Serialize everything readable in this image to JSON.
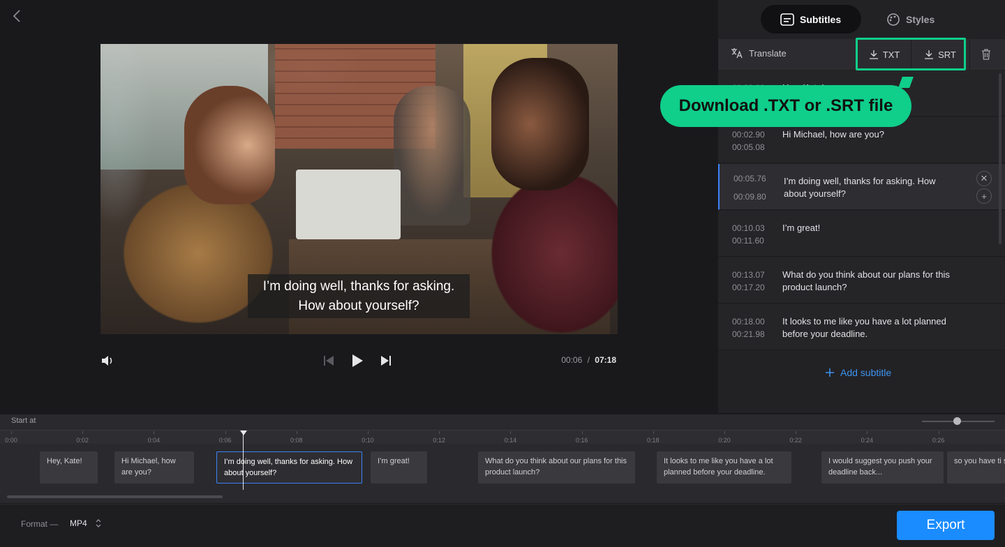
{
  "video": {
    "caption_line1": "I’m doing well, thanks for asking.",
    "caption_line2": "How about yourself?",
    "current_time": "00:06",
    "separator": "/",
    "total_time": "07:18"
  },
  "panel": {
    "tabs": [
      {
        "label": "Subtitles",
        "icon": "subtitles-icon",
        "active": true
      },
      {
        "label": "Styles",
        "icon": "palette-icon",
        "active": false
      }
    ],
    "toolbar": {
      "translate_label": "Translate",
      "txt_label": "TXT",
      "srt_label": "SRT"
    },
    "subtitles": [
      {
        "start": "00:00.00",
        "end": "",
        "text": "Hey, Kate!"
      },
      {
        "start": "00:02.90",
        "end": "00:05.08",
        "text": "Hi Michael, how are you?"
      },
      {
        "start": "00:05.76",
        "end": "00:09.80",
        "text": "I’m doing well, thanks for asking. How about yourself?",
        "selected": true
      },
      {
        "start": "00:10.03",
        "end": "00:11.60",
        "text": "I’m great!"
      },
      {
        "start": "00:13.07",
        "end": "00:17.20",
        "text": "What do you think about our plans for this product launch?"
      },
      {
        "start": "00:18.00",
        "end": "00:21.98",
        "text": "It looks to me like you have a lot planned before your deadline."
      }
    ],
    "add_subtitle_label": "Add subtitle"
  },
  "tooltip": {
    "text": "Download .TXT or .SRT file"
  },
  "timeline": {
    "start_at_label": "Start at",
    "ticks": [
      "0:00",
      "0:02",
      "0:04",
      "0:06",
      "0:08",
      "0:10",
      "0:12",
      "0:14",
      "0:16",
      "0:18",
      "0:20",
      "0:22",
      "0:24",
      "0:26"
    ],
    "clips": [
      {
        "text": "Hey, Kate!"
      },
      {
        "text": "Hi Michael, how are you?"
      },
      {
        "text": "I’m doing well, thanks for asking. How about yourself?",
        "selected": true
      },
      {
        "text": "I’m great!"
      },
      {
        "text": "What do you think about our plans for this product launch?"
      },
      {
        "text": "It looks to me like you have a lot planned before your deadline."
      },
      {
        "text": "I would suggest you push your deadline back..."
      },
      {
        "text": "so you have ti successful ad"
      }
    ]
  },
  "footer": {
    "format_label": "Format —",
    "format_value": "MP4",
    "export_label": "Export"
  },
  "colors": {
    "accent_green": "#0fcf8a",
    "accent_blue": "#1a8cff",
    "link_blue": "#3e94f0"
  }
}
